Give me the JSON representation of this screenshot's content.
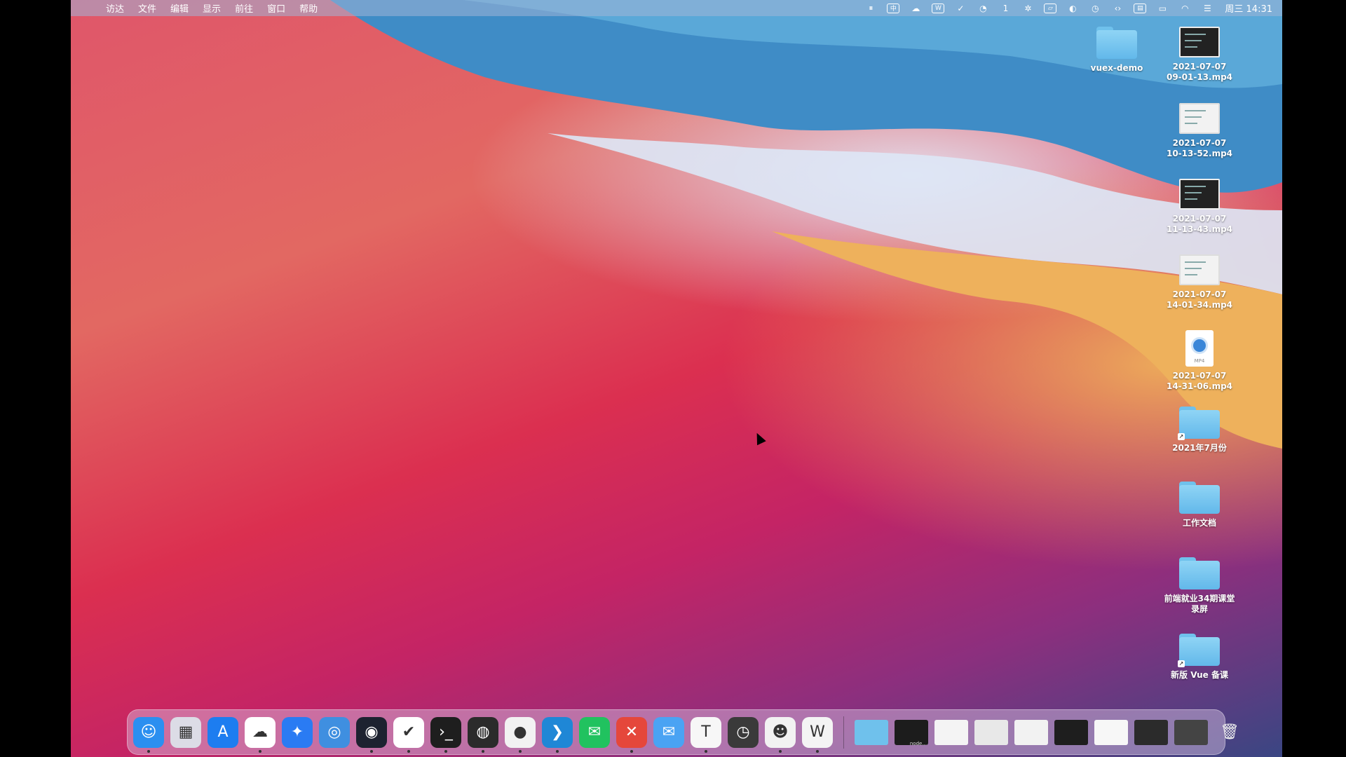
{
  "menubar": {
    "apple": "",
    "items": [
      "访达",
      "文件",
      "编辑",
      "显示",
      "前往",
      "窗口",
      "帮助"
    ],
    "status_icons": [
      {
        "name": "pause-icon",
        "glyph": "⏸",
        "box": false
      },
      {
        "name": "input-method-icon",
        "glyph": "中",
        "box": true
      },
      {
        "name": "baidu-netdisk-icon",
        "glyph": "☁",
        "box": false
      },
      {
        "name": "wps-icon",
        "glyph": "W",
        "box": true
      },
      {
        "name": "check-icon",
        "glyph": "✓",
        "box": false
      },
      {
        "name": "globe-icon",
        "glyph": "◔",
        "box": false
      },
      {
        "name": "notification-icon",
        "glyph": "1",
        "box": false
      },
      {
        "name": "aperture-icon",
        "glyph": "✲",
        "box": false
      },
      {
        "name": "screen-icon",
        "glyph": "▱",
        "box": true
      },
      {
        "name": "cat-icon",
        "glyph": "◐",
        "box": false
      },
      {
        "name": "timemachine-icon",
        "glyph": "◷",
        "box": false
      },
      {
        "name": "code-icon",
        "glyph": "‹›",
        "box": false
      },
      {
        "name": "monitor-icon",
        "glyph": "▤",
        "box": true
      },
      {
        "name": "battery-icon",
        "glyph": "▭",
        "box": false
      },
      {
        "name": "wifi-icon",
        "glyph": "◠",
        "box": false
      },
      {
        "name": "control-center-icon",
        "glyph": "☰",
        "box": false
      }
    ],
    "clock": "周三 14:31"
  },
  "desktop": [
    {
      "type": "folder",
      "name": "vuex-demo",
      "alias": false
    },
    {
      "type": "video",
      "name": "2021-07-07\n09-01-13.mp4",
      "style": "dark"
    },
    {
      "type": "video",
      "name": "2021-07-07\n10-13-52.mp4",
      "style": "light"
    },
    {
      "type": "video",
      "name": "2021-07-07\n11-13-43.mp4",
      "style": "dark"
    },
    {
      "type": "video",
      "name": "2021-07-07\n14-01-34.mp4",
      "style": "light"
    },
    {
      "type": "mp4doc",
      "name": "2021-07-07\n14-31-06.mp4",
      "badge": "MP4"
    },
    {
      "type": "folder",
      "name": "2021年7月份",
      "alias": true
    },
    {
      "type": "folder",
      "name": "工作文档",
      "alias": false
    },
    {
      "type": "folder",
      "name": "前端就业34期课堂\n录屏",
      "alias": false
    },
    {
      "type": "folder",
      "name": "新版 Vue 备课",
      "alias": true
    }
  ],
  "dock": {
    "apps": [
      {
        "name": "finder",
        "glyph": "☺",
        "bg": "#2b8ff0",
        "running": true
      },
      {
        "name": "launchpad",
        "glyph": "▦",
        "bg": "#dcdce6",
        "running": false
      },
      {
        "name": "app-store",
        "glyph": "A",
        "bg": "#1d7df0",
        "running": false
      },
      {
        "name": "baidu-netdisk",
        "glyph": "☁",
        "bg": "#ffffff",
        "running": true
      },
      {
        "name": "xcode-pin",
        "glyph": "✦",
        "bg": "#2a7bf3",
        "running": false
      },
      {
        "name": "proxyman",
        "glyph": "◎",
        "bg": "#3f8fe0",
        "running": false
      },
      {
        "name": "obs",
        "glyph": "◉",
        "bg": "#1d2230",
        "running": true
      },
      {
        "name": "tasks",
        "glyph": "✔",
        "bg": "#ffffff",
        "running": true
      },
      {
        "name": "terminal",
        "glyph": "›_",
        "bg": "#1e1e1e",
        "running": true
      },
      {
        "name": "sync-app",
        "glyph": "◍",
        "bg": "#2b2b2b",
        "running": true
      },
      {
        "name": "chrome",
        "glyph": "●",
        "bg": "#f2f2f2",
        "running": true
      },
      {
        "name": "vscode",
        "glyph": "❯",
        "bg": "#1f87d6",
        "running": true
      },
      {
        "name": "wechat",
        "glyph": "✉",
        "bg": "#21c25f",
        "running": false
      },
      {
        "name": "xmind",
        "glyph": "✕",
        "bg": "#e5473b",
        "running": true
      },
      {
        "name": "mail",
        "glyph": "✉",
        "bg": "#4aa3f3",
        "running": false
      },
      {
        "name": "typora",
        "glyph": "T",
        "bg": "#f7f7f7",
        "running": true
      },
      {
        "name": "clock",
        "glyph": "◷",
        "bg": "#3a3a3a",
        "running": false
      },
      {
        "name": "qq",
        "glyph": "☻",
        "bg": "#f2f2f2",
        "running": true
      },
      {
        "name": "wps",
        "glyph": "W",
        "bg": "#f4f4f4",
        "running": true
      }
    ],
    "windows": [
      {
        "name": "downloads-folder",
        "bg": "#6fc1ec"
      },
      {
        "name": "terminal-window",
        "bg": "#1c1c1c",
        "label": "node..."
      },
      {
        "name": "finder-window-1",
        "bg": "#f4f4f4"
      },
      {
        "name": "finder-window-2",
        "bg": "#e8e8e8"
      },
      {
        "name": "chrome-window",
        "bg": "#f2f2f2"
      },
      {
        "name": "vscode-window",
        "bg": "#1e1e1e"
      },
      {
        "name": "typora-window",
        "bg": "#f7f7f7"
      },
      {
        "name": "obs-window",
        "bg": "#2b2b2b"
      },
      {
        "name": "video-window",
        "bg": "#444"
      }
    ],
    "trash": {
      "name": "trash",
      "glyph": "🗑"
    }
  }
}
